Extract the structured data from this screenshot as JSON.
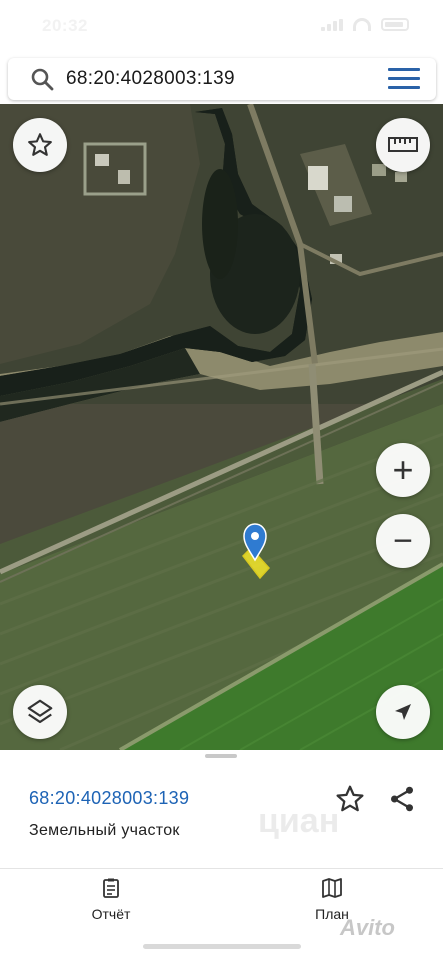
{
  "status_bar": {
    "time": "20:32"
  },
  "search": {
    "value": "68:20:4028003:139"
  },
  "map": {
    "favorite_button": "star-icon",
    "ruler_button": "ruler-icon",
    "zoom_in_label": "+",
    "zoom_out_label": "−",
    "layers_button": "layers-icon",
    "locate_button": "navigation-arrow-icon",
    "parcel_color": "#f5e62a",
    "marker_color": "#2f7bd1"
  },
  "parcel_card": {
    "cadastral_number": "68:20:4028003:139",
    "type": "Земельный участок",
    "link_color": "#1d63b5"
  },
  "tabs": [
    {
      "label": "Отчёт",
      "icon": "report-icon"
    },
    {
      "label": "План",
      "icon": "map-plan-icon"
    }
  ],
  "watermark": {
    "text": "Avito",
    "ghost_text": "циан"
  }
}
